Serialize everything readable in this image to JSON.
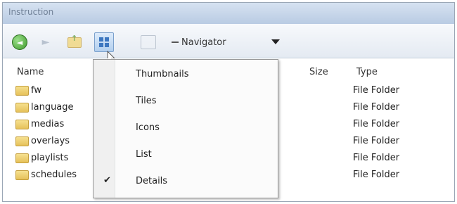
{
  "window": {
    "title": "Instruction"
  },
  "toolbar": {
    "back_glyph": "◄",
    "forward_glyph": "►",
    "navigator_label": "Navigator"
  },
  "columns": {
    "name": "Name",
    "size": "Size",
    "type": "Type"
  },
  "files": [
    {
      "name": "fw",
      "type": "File Folder"
    },
    {
      "name": "language",
      "type": "File Folder"
    },
    {
      "name": "medias",
      "type": "File Folder"
    },
    {
      "name": "overlays",
      "type": "File Folder"
    },
    {
      "name": "playlists",
      "type": "File Folder"
    },
    {
      "name": "schedules",
      "type": "File Folder"
    }
  ],
  "view_menu": {
    "items": [
      {
        "label": "Thumbnails",
        "checked": false
      },
      {
        "label": "Tiles",
        "checked": false
      },
      {
        "label": "Icons",
        "checked": false
      },
      {
        "label": "List",
        "checked": false
      },
      {
        "label": "Details",
        "checked": true
      }
    ],
    "check_glyph": "✔"
  }
}
